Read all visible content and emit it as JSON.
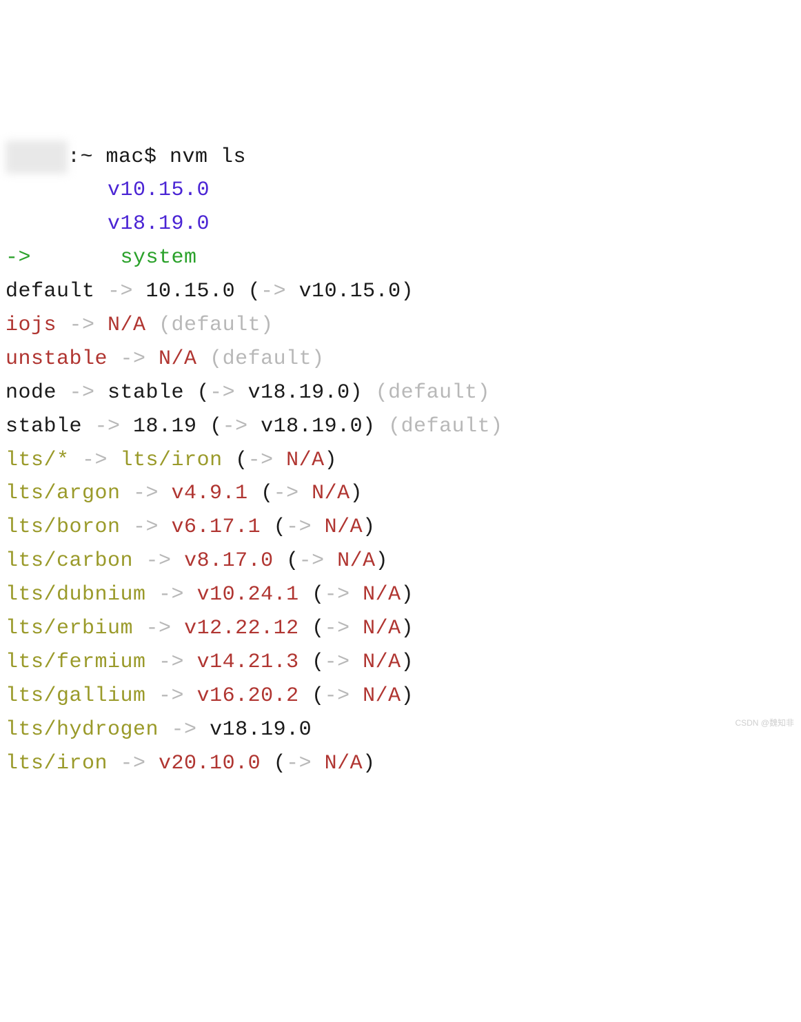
{
  "prompt": {
    "redacted": "     ",
    "rest": ":~ mac$ nvm ls"
  },
  "installed": [
    {
      "indent": "        ",
      "version": "v10.15.0"
    },
    {
      "indent": "        ",
      "version": "v18.19.0"
    }
  ],
  "current": {
    "arrow": "->",
    "indent": "       ",
    "label": "system"
  },
  "aliases": [
    {
      "segments": [
        {
          "text": "default ",
          "cls": "black"
        },
        {
          "text": "->",
          "cls": "gray"
        },
        {
          "text": " 10.15.0 (",
          "cls": "black"
        },
        {
          "text": "->",
          "cls": "gray"
        },
        {
          "text": " v10.15.0)",
          "cls": "black"
        }
      ]
    },
    {
      "segments": [
        {
          "text": "iojs ",
          "cls": "red"
        },
        {
          "text": "->",
          "cls": "gray"
        },
        {
          "text": " N/A",
          "cls": "red"
        },
        {
          "text": " (default)",
          "cls": "gray"
        }
      ]
    },
    {
      "segments": [
        {
          "text": "unstable ",
          "cls": "red"
        },
        {
          "text": "->",
          "cls": "gray"
        },
        {
          "text": " N/A",
          "cls": "red"
        },
        {
          "text": " (default)",
          "cls": "gray"
        }
      ]
    },
    {
      "segments": [
        {
          "text": "node ",
          "cls": "black"
        },
        {
          "text": "->",
          "cls": "gray"
        },
        {
          "text": " stable (",
          "cls": "black"
        },
        {
          "text": "->",
          "cls": "gray"
        },
        {
          "text": " v18.19.0)",
          "cls": "black"
        },
        {
          "text": " (default)",
          "cls": "gray"
        }
      ]
    },
    {
      "segments": [
        {
          "text": "stable ",
          "cls": "black"
        },
        {
          "text": "->",
          "cls": "gray"
        },
        {
          "text": " 18.19 (",
          "cls": "black"
        },
        {
          "text": "->",
          "cls": "gray"
        },
        {
          "text": " v18.19.0)",
          "cls": "black"
        },
        {
          "text": " (default)",
          "cls": "gray"
        }
      ]
    },
    {
      "segments": [
        {
          "text": "lts/* ",
          "cls": "olive"
        },
        {
          "text": "->",
          "cls": "gray"
        },
        {
          "text": " lts/iron",
          "cls": "olive"
        },
        {
          "text": " (",
          "cls": "black"
        },
        {
          "text": "->",
          "cls": "gray"
        },
        {
          "text": " N/A",
          "cls": "red"
        },
        {
          "text": ")",
          "cls": "black"
        }
      ]
    },
    {
      "segments": [
        {
          "text": "lts/argon ",
          "cls": "olive"
        },
        {
          "text": "->",
          "cls": "gray"
        },
        {
          "text": " v4.9.1",
          "cls": "red"
        },
        {
          "text": " (",
          "cls": "black"
        },
        {
          "text": "->",
          "cls": "gray"
        },
        {
          "text": " N/A",
          "cls": "red"
        },
        {
          "text": ")",
          "cls": "black"
        }
      ]
    },
    {
      "segments": [
        {
          "text": "lts/boron ",
          "cls": "olive"
        },
        {
          "text": "->",
          "cls": "gray"
        },
        {
          "text": " v6.17.1",
          "cls": "red"
        },
        {
          "text": " (",
          "cls": "black"
        },
        {
          "text": "->",
          "cls": "gray"
        },
        {
          "text": " N/A",
          "cls": "red"
        },
        {
          "text": ")",
          "cls": "black"
        }
      ]
    },
    {
      "segments": [
        {
          "text": "lts/carbon ",
          "cls": "olive"
        },
        {
          "text": "->",
          "cls": "gray"
        },
        {
          "text": " v8.17.0",
          "cls": "red"
        },
        {
          "text": " (",
          "cls": "black"
        },
        {
          "text": "->",
          "cls": "gray"
        },
        {
          "text": " N/A",
          "cls": "red"
        },
        {
          "text": ")",
          "cls": "black"
        }
      ]
    },
    {
      "segments": [
        {
          "text": "lts/dubnium ",
          "cls": "olive"
        },
        {
          "text": "->",
          "cls": "gray"
        },
        {
          "text": " v10.24.1",
          "cls": "red"
        },
        {
          "text": " (",
          "cls": "black"
        },
        {
          "text": "->",
          "cls": "gray"
        },
        {
          "text": " N/A",
          "cls": "red"
        },
        {
          "text": ")",
          "cls": "black"
        }
      ]
    },
    {
      "segments": [
        {
          "text": "lts/erbium ",
          "cls": "olive"
        },
        {
          "text": "->",
          "cls": "gray"
        },
        {
          "text": " v12.22.12",
          "cls": "red"
        },
        {
          "text": " (",
          "cls": "black"
        },
        {
          "text": "->",
          "cls": "gray"
        },
        {
          "text": " N/A",
          "cls": "red"
        },
        {
          "text": ")",
          "cls": "black"
        }
      ]
    },
    {
      "segments": [
        {
          "text": "lts/fermium ",
          "cls": "olive"
        },
        {
          "text": "->",
          "cls": "gray"
        },
        {
          "text": " v14.21.3",
          "cls": "red"
        },
        {
          "text": " (",
          "cls": "black"
        },
        {
          "text": "->",
          "cls": "gray"
        },
        {
          "text": " N/A",
          "cls": "red"
        },
        {
          "text": ")",
          "cls": "black"
        }
      ]
    },
    {
      "segments": [
        {
          "text": "lts/gallium ",
          "cls": "olive"
        },
        {
          "text": "->",
          "cls": "gray"
        },
        {
          "text": " v16.20.2",
          "cls": "red"
        },
        {
          "text": " (",
          "cls": "black"
        },
        {
          "text": "->",
          "cls": "gray"
        },
        {
          "text": " N/A",
          "cls": "red"
        },
        {
          "text": ")",
          "cls": "black"
        }
      ]
    },
    {
      "segments": [
        {
          "text": "lts/hydrogen ",
          "cls": "olive"
        },
        {
          "text": "->",
          "cls": "gray"
        },
        {
          "text": " v18.19.0",
          "cls": "black"
        }
      ]
    },
    {
      "segments": [
        {
          "text": "lts/iron ",
          "cls": "olive"
        },
        {
          "text": "->",
          "cls": "gray"
        },
        {
          "text": " v20.10.0",
          "cls": "red"
        },
        {
          "text": " (",
          "cls": "black"
        },
        {
          "text": "->",
          "cls": "gray"
        },
        {
          "text": " N/A",
          "cls": "red"
        },
        {
          "text": ")",
          "cls": "black"
        }
      ]
    }
  ],
  "watermark": "CSDN @魏知非"
}
